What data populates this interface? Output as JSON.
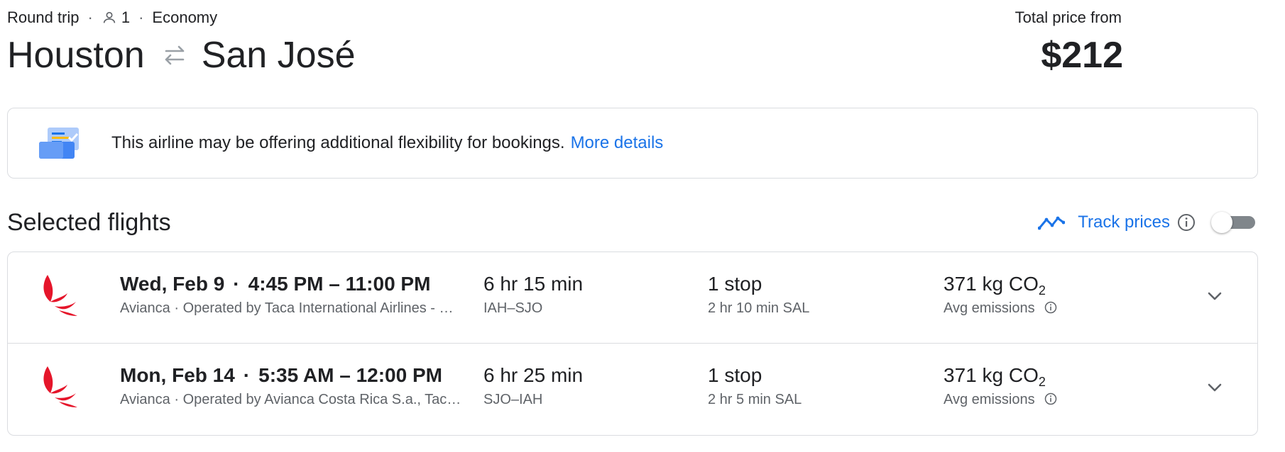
{
  "header": {
    "trip_type": "Round trip",
    "passengers": "1",
    "cabin": "Economy",
    "origin": "Houston",
    "destination": "San José",
    "price_label": "Total price from",
    "price": "$212"
  },
  "banner": {
    "text": "This airline may be offering additional flexibility for bookings.",
    "link": "More details"
  },
  "section": {
    "title": "Selected flights",
    "track_label": "Track prices",
    "track_enabled": false
  },
  "flights": [
    {
      "date": "Wed, Feb 9",
      "times": "4:45 PM – 11:00 PM",
      "airline": "Avianca · Operated by Taca International Airlines - …",
      "duration": "6 hr 15 min",
      "route": "IAH–SJO",
      "stops": "1 stop",
      "layover": "2 hr 10 min SAL",
      "emissions_value": "371 kg CO",
      "emissions_sub": "2",
      "emissions_label": "Avg emissions"
    },
    {
      "date": "Mon, Feb 14",
      "times": "5:35 AM – 12:00 PM",
      "airline": "Avianca · Operated by Avianca Costa Rica S.a., Tac…",
      "duration": "6 hr 25 min",
      "route": "SJO–IAH",
      "stops": "1 stop",
      "layover": "2 hr 5 min SAL",
      "emissions_value": "371 kg CO",
      "emissions_sub": "2",
      "emissions_label": "Avg emissions"
    }
  ],
  "colors": {
    "link": "#1a73e8",
    "border": "#dadce0",
    "airline_red": "#e5152a",
    "muted": "#5f6368"
  },
  "icons": {
    "person": "person-icon",
    "swap": "swap-arrows-icon",
    "banner": "flexible-booking-icon",
    "trend": "price-trend-icon",
    "info": "info-icon",
    "airline": "avianca-logo",
    "expand": "chevron-down-icon"
  }
}
